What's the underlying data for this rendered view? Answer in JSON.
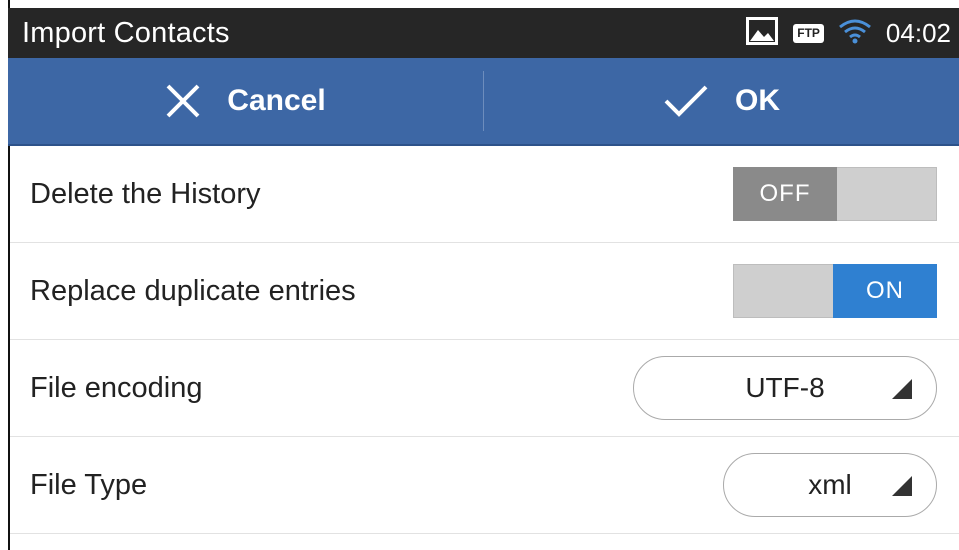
{
  "statusbar": {
    "title": "Import Contacts",
    "ftp_label": "FTP",
    "time": "04:02",
    "icons": [
      "image-icon",
      "ftp-icon",
      "wifi-icon"
    ]
  },
  "actionbar": {
    "cancel_label": "Cancel",
    "ok_label": "OK",
    "color": "#3d67a5"
  },
  "settings": [
    {
      "label": "Delete the History",
      "type": "toggle",
      "state": "OFF"
    },
    {
      "label": "Replace duplicate entries",
      "type": "toggle",
      "state": "ON"
    },
    {
      "label": "File encoding",
      "type": "select",
      "value": "UTF-8"
    },
    {
      "label": "File Type",
      "type": "select",
      "value": "xml"
    }
  ],
  "colors": {
    "toggle_on": "#2f80d1",
    "toggle_off": "#8a8a8a",
    "statusbar": "#262626"
  }
}
